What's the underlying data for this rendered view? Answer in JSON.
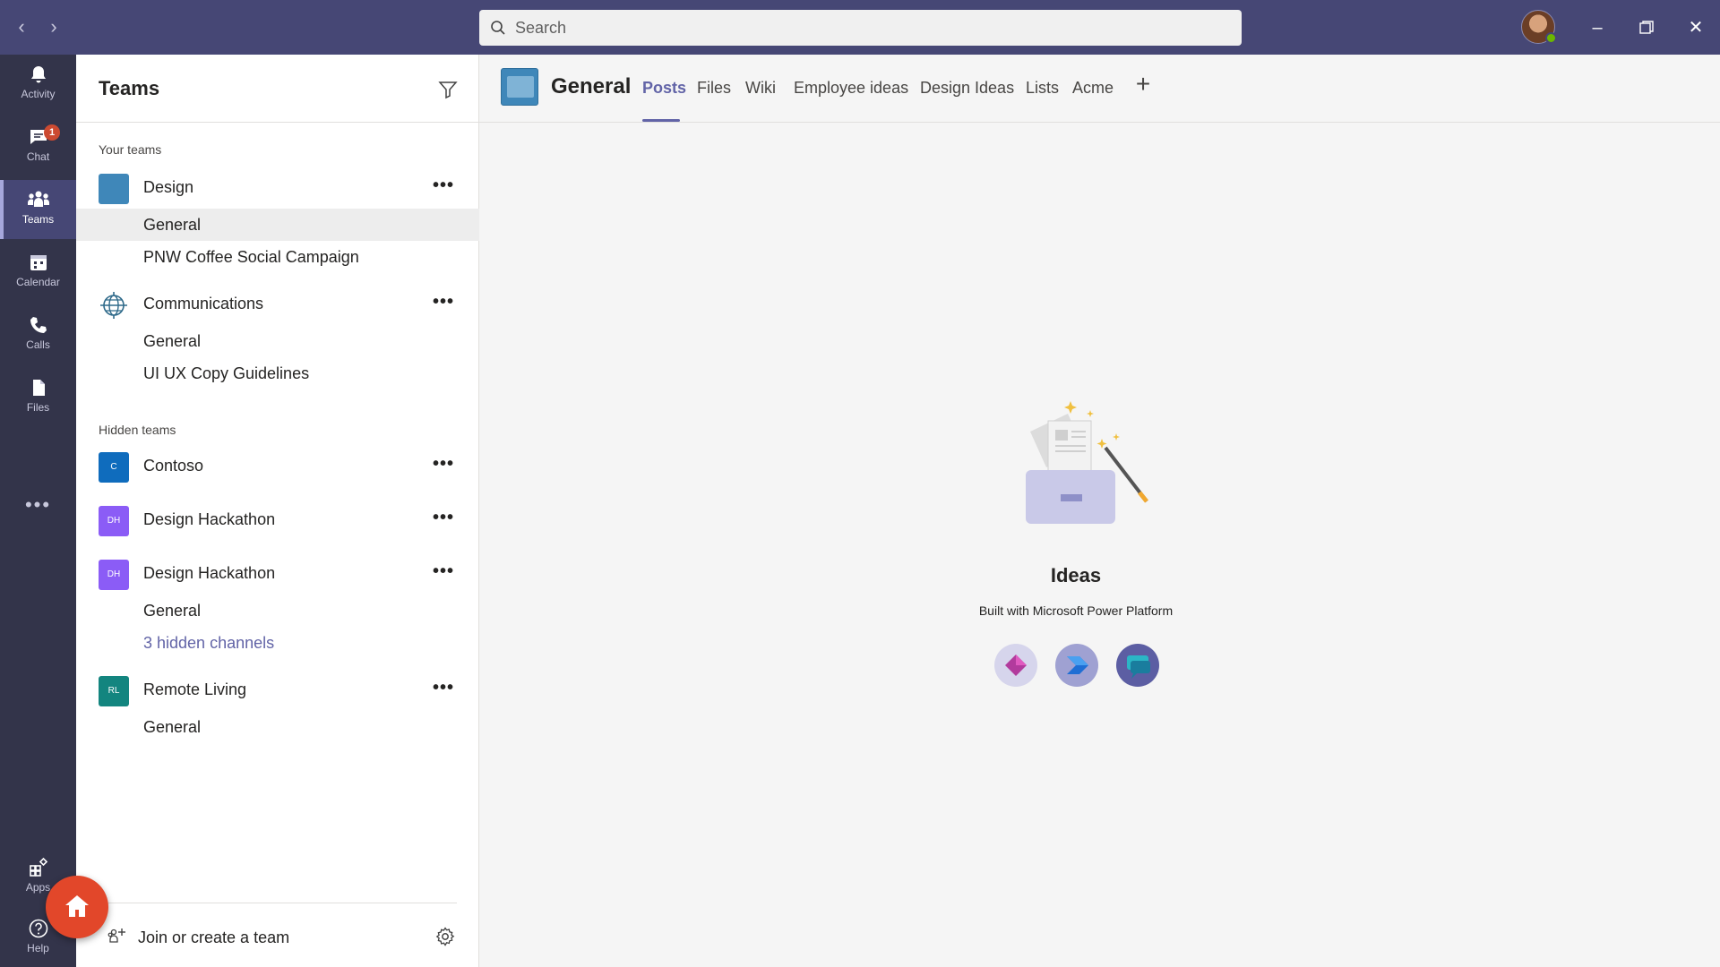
{
  "titlebar": {
    "back_icon": "chevron-left-icon",
    "forward_icon": "chevron-right-icon",
    "search_placeholder": "Search",
    "minimize": "minimize-icon",
    "restore": "restore-icon",
    "close": "close-icon"
  },
  "appbar": {
    "items": [
      {
        "label": "Activity",
        "icon": "bell-icon"
      },
      {
        "label": "Chat",
        "icon": "chat-icon",
        "badge": "1"
      },
      {
        "label": "Teams",
        "icon": "teams-icon"
      },
      {
        "label": "Calendar",
        "icon": "calendar-icon"
      },
      {
        "label": "Calls",
        "icon": "phone-icon"
      },
      {
        "label": "Files",
        "icon": "file-icon"
      }
    ],
    "more": "•••",
    "bottom": [
      {
        "label": "Apps",
        "icon": "apps-icon"
      },
      {
        "label": "Help",
        "icon": "help-icon"
      }
    ]
  },
  "teams_panel": {
    "title": "Teams",
    "your_teams_label": "Your teams",
    "hidden_teams_label": "Hidden teams",
    "teams": [
      {
        "name": "Design",
        "channels": [
          "General",
          "PNW Coffee Social Campaign"
        ]
      },
      {
        "name": "Communications",
        "channels": [
          "General",
          "UI UX Copy Guidelines"
        ]
      }
    ],
    "hidden_teams": [
      {
        "name": "Contoso",
        "initials": "C",
        "color": "#0f6cbd"
      },
      {
        "name": "Design Hackathon",
        "initials": "DH",
        "color": "#8b5cf6"
      },
      {
        "name": "Design Hackathon",
        "initials": "DH",
        "color": "#8b5cf6",
        "channels": [
          "General"
        ],
        "hidden_channels": "3 hidden channels"
      },
      {
        "name": "Remote Living",
        "initials": "RL",
        "color": "#13857f",
        "channels": [
          "General"
        ]
      }
    ],
    "more": "•••",
    "join_label": "Join or create a team"
  },
  "main": {
    "channel_title": "General",
    "tabs": [
      "Posts",
      "Files",
      "Wiki",
      "Employee ideas",
      "Design Ideas",
      "Lists",
      "Acme"
    ],
    "active_tab": "Posts",
    "add_tab": "+",
    "empty_state": {
      "title": "Ideas",
      "subtitle": "Built with Microsoft Power Platform"
    }
  },
  "colors": {
    "titlebar": "#464775",
    "appbar": "#33344a",
    "accent": "#6264a7",
    "home_fab": "#e2472a"
  }
}
